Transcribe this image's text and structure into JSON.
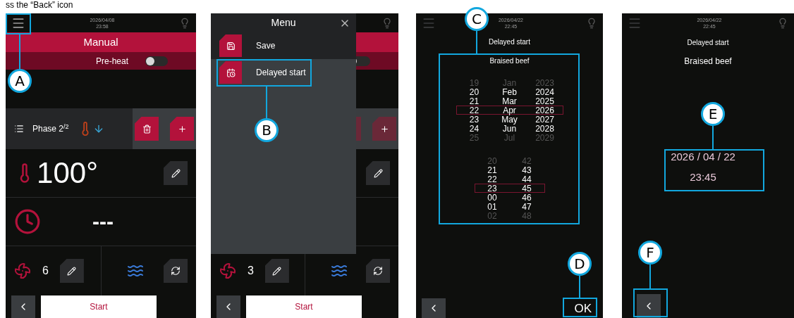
{
  "caption": "ss the “Back” icon",
  "screens": [
    {
      "kind": "program",
      "header": {
        "date": "2026/04/08",
        "time": "23:58"
      },
      "title": "Manual",
      "preheat": {
        "label": "Pre-heat",
        "on": false
      },
      "phase": "Phase 2$^{/2}$",
      "temperature": "100°",
      "duration": "---",
      "fan_speed": "6",
      "start": "Start",
      "callouts": [
        {
          "label": "A"
        }
      ]
    },
    {
      "kind": "menu",
      "menu": {
        "title": "Menu",
        "items": [
          {
            "kind": "save",
            "label": "Save"
          },
          {
            "kind": "schedule",
            "label": "Delayed start"
          }
        ]
      },
      "preheat": {
        "on": false
      },
      "fan_speed": "3",
      "start": "Start",
      "callouts": [
        {
          "label": "B"
        }
      ]
    },
    {
      "kind": "picker",
      "header": {
        "date": "2026/04/22",
        "time": "22:45"
      },
      "title": "Delayed start",
      "recipe": "Braised beef",
      "date_rows": [
        {
          "cells": [
            "19",
            "Jan",
            "2023"
          ],
          "selected": false
        },
        {
          "cells": [
            "20",
            "Feb",
            "2024"
          ],
          "selected": false
        },
        {
          "cells": [
            "21",
            "Mar",
            "2025"
          ],
          "selected": false
        },
        {
          "cells": [
            "22",
            "Apr",
            "2026"
          ],
          "selected": true
        },
        {
          "cells": [
            "23",
            "May",
            "2027"
          ],
          "selected": false
        },
        {
          "cells": [
            "24",
            "Jun",
            "2028"
          ],
          "selected": false
        },
        {
          "cells": [
            "25",
            "Jul",
            "2029"
          ],
          "selected": false
        }
      ],
      "time_rows": [
        {
          "cells": [
            "20",
            "42"
          ],
          "selected": false
        },
        {
          "cells": [
            "21",
            "43"
          ],
          "selected": false
        },
        {
          "cells": [
            "22",
            "44"
          ],
          "selected": false
        },
        {
          "cells": [
            "23",
            "45"
          ],
          "selected": true
        },
        {
          "cells": [
            "00",
            "46"
          ],
          "selected": false
        },
        {
          "cells": [
            "01",
            "47"
          ],
          "selected": false
        },
        {
          "cells": [
            "02",
            "48"
          ],
          "selected": false
        }
      ],
      "ok": "OK",
      "callouts": [
        {
          "label": "C"
        },
        {
          "label": "D"
        }
      ]
    },
    {
      "kind": "summary",
      "header": {
        "date": "2026/04/22",
        "time": "22:45"
      },
      "title": "Delayed start",
      "recipe": "Braised beef",
      "date": "2026 / 04 / 22",
      "time": "23:45",
      "callouts": [
        {
          "label": "E"
        },
        {
          "label": "F"
        }
      ]
    }
  ]
}
